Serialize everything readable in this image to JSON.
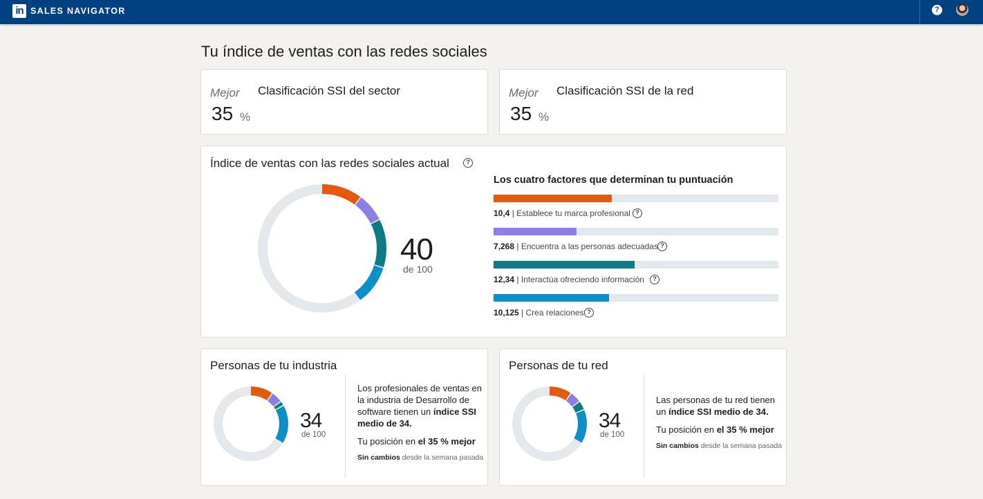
{
  "header": {
    "logo": "in",
    "brand": "SALES NAVIGATOR",
    "help_icon": "?",
    "colors": {
      "bar": "#004182"
    }
  },
  "page_title": "Tu índice de ventas con las redes sociales",
  "rankings": [
    {
      "label": "Mejor",
      "title": "Clasificación SSI del sector",
      "value": "35",
      "unit": "%"
    },
    {
      "label": "Mejor",
      "title": "Clasificación SSI de la red",
      "value": "35",
      "unit": "%"
    }
  ],
  "current": {
    "title": "Índice de ventas con las redes sociales actual",
    "score": "40",
    "of": "de 100",
    "factors_title": "Los cuatro factores que determinan tu puntuación",
    "factors": [
      {
        "value": "10,4",
        "label": "Establece tu marca profesional",
        "fraction": 0.416,
        "color": "#e35a0c"
      },
      {
        "value": "7,268",
        "label": "Encuentra a las personas adecuadas",
        "fraction": 0.291,
        "color": "#8b7fe3"
      },
      {
        "value": "12,34",
        "label": "Interactúa ofreciendo información",
        "fraction": 0.494,
        "color": "#0e7a84"
      },
      {
        "value": "10,125",
        "label": "Crea relaciones",
        "fraction": 0.405,
        "color": "#0b8fc9"
      }
    ],
    "ring_segments": [
      10.4,
      7.268,
      12.34,
      10.125
    ],
    "ring_track_color": "#e3e8ec"
  },
  "industry": {
    "title": "Personas de tu industria",
    "score": "34",
    "of": "de 100",
    "ring_segments": [
      10,
      5,
      2,
      17
    ],
    "text_before": "Los profesionales de ventas en la industria de Desarrollo de software tienen un ",
    "text_bold": "índice SSI medio de 34.",
    "position_before": "Tu posición en ",
    "position_bold": "el 35 % mejor",
    "change_bold": "Sin cambios",
    "change_rest": " desde la semana pasada"
  },
  "network": {
    "title": "Personas de tu red",
    "score": "34",
    "of": "de 100",
    "ring_segments": [
      10,
      5,
      4,
      15
    ],
    "text_before": "Las personas de tu red tienen un ",
    "text_bold": "índice SSI medio de 34.",
    "position_before": "Tu posición en ",
    "position_bold": "el 35 % mejor",
    "change_bold": "Sin cambios",
    "change_rest": " desde la semana pasada"
  },
  "segment_colors": [
    "#e35a0c",
    "#8b7fe3",
    "#0e7a84",
    "#0b8fc9"
  ]
}
